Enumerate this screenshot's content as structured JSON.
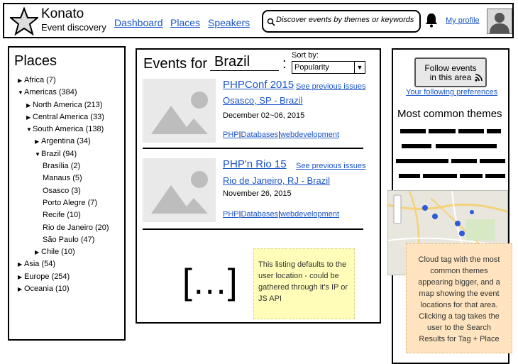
{
  "brand": {
    "name": "Konato",
    "tagline": "Event discovery"
  },
  "nav": [
    {
      "label": "Dashboard"
    },
    {
      "label": "Places"
    },
    {
      "label": "Speakers"
    }
  ],
  "search": {
    "placeholder": "Discover events by themes or keywords"
  },
  "profile": {
    "label": "My profile"
  },
  "places": {
    "title": "Places",
    "items": [
      {
        "label": "Africa (7)",
        "state": "collapsed"
      },
      {
        "label": "Americas (384)",
        "state": "expanded"
      },
      {
        "label": "North America (213)",
        "state": "collapsed"
      },
      {
        "label": "Central America (33)",
        "state": "collapsed"
      },
      {
        "label": "South America (138)",
        "state": "expanded"
      },
      {
        "label": "Argentina (34)",
        "state": "collapsed"
      },
      {
        "label": "Brazil (94)",
        "state": "expanded"
      },
      {
        "label": "Brasília (2)",
        "state": "leaf"
      },
      {
        "label": "Manaus (5)",
        "state": "leaf"
      },
      {
        "label": "Osasco (3)",
        "state": "leaf"
      },
      {
        "label": "Porto Alegre (7)",
        "state": "leaf"
      },
      {
        "label": "Recife (10)",
        "state": "leaf"
      },
      {
        "label": "Rio de Janeiro (20)",
        "state": "leaf"
      },
      {
        "label": "São Paulo (47)",
        "state": "leaf"
      },
      {
        "label": "Chile (10)",
        "state": "collapsed"
      },
      {
        "label": "Asia (54)",
        "state": "collapsed"
      },
      {
        "label": "Europe (254)",
        "state": "collapsed"
      },
      {
        "label": "Oceania (10)",
        "state": "collapsed"
      }
    ]
  },
  "events": {
    "heading": "Events for",
    "country": "Brazil",
    "colon": ":",
    "sort_label": "Sort by:",
    "sort_value": "Popularity",
    "items": [
      {
        "title": "PHPConf 2015",
        "previous": "See previous issues",
        "place": "Osasco, SP - Brazil",
        "date": "December 02~06, 2015",
        "tags": [
          "PHP",
          "Databases",
          "webdevelopment"
        ]
      },
      {
        "title": "PHP'n Rio 15",
        "previous": "See previous issues",
        "place": "Rio de Janeiro, RJ - Brazil",
        "date": "November 26, 2015",
        "tags": [
          "PHP",
          "Databases",
          "webdevelopment"
        ]
      }
    ],
    "more": "[...]",
    "note": "This listing defaults to the user location - could be gathered through it's IP or JS API"
  },
  "right": {
    "follow_button": "Follow events in this area",
    "preferences_link": "Your following preferences",
    "themes_title": "Most common themes",
    "note": "Cloud tag with the most common themes appearing bigger, and a map showing the event locations for that area. Clicking a tag takes the user to the Search Results for Tag + Place"
  },
  "colors": {
    "link": "#1a55c8",
    "sticky_yellow": "#fffdb8",
    "sticky_orange": "#ffe4bf"
  }
}
